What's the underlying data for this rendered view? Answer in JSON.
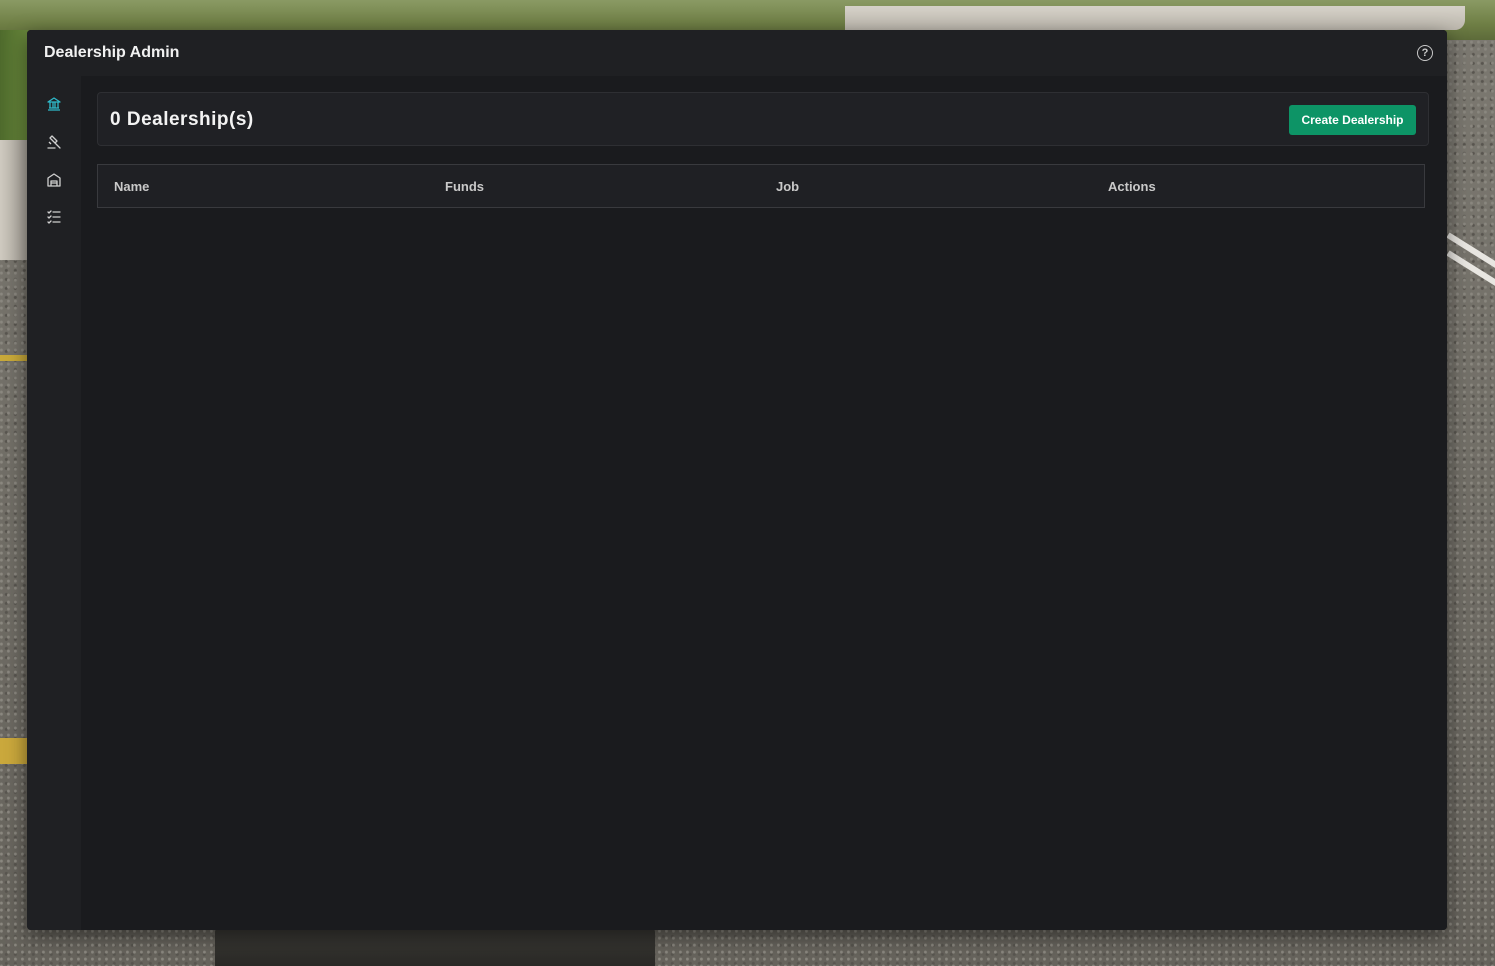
{
  "window": {
    "title": "Dealership Admin",
    "help_icon": "question-circle-icon",
    "help_glyph": "?"
  },
  "sidebar": {
    "items": [
      {
        "id": "dealerships",
        "icon": "bank-icon",
        "active": true
      },
      {
        "id": "tools",
        "icon": "hammer-icon",
        "active": false
      },
      {
        "id": "garage",
        "icon": "building-icon",
        "active": false
      },
      {
        "id": "list",
        "icon": "checklist-icon",
        "active": false
      }
    ]
  },
  "header": {
    "count_text": "0 Dealership(s)",
    "create_button": "Create Dealership"
  },
  "table": {
    "columns": [
      "Name",
      "Funds",
      "Job",
      "Actions"
    ],
    "rows": []
  },
  "colors": {
    "accent": "#0d9466",
    "active_icon": "#2fb9c9",
    "icon": "#cfcfcf",
    "window_bg": "#1a1b1e"
  }
}
